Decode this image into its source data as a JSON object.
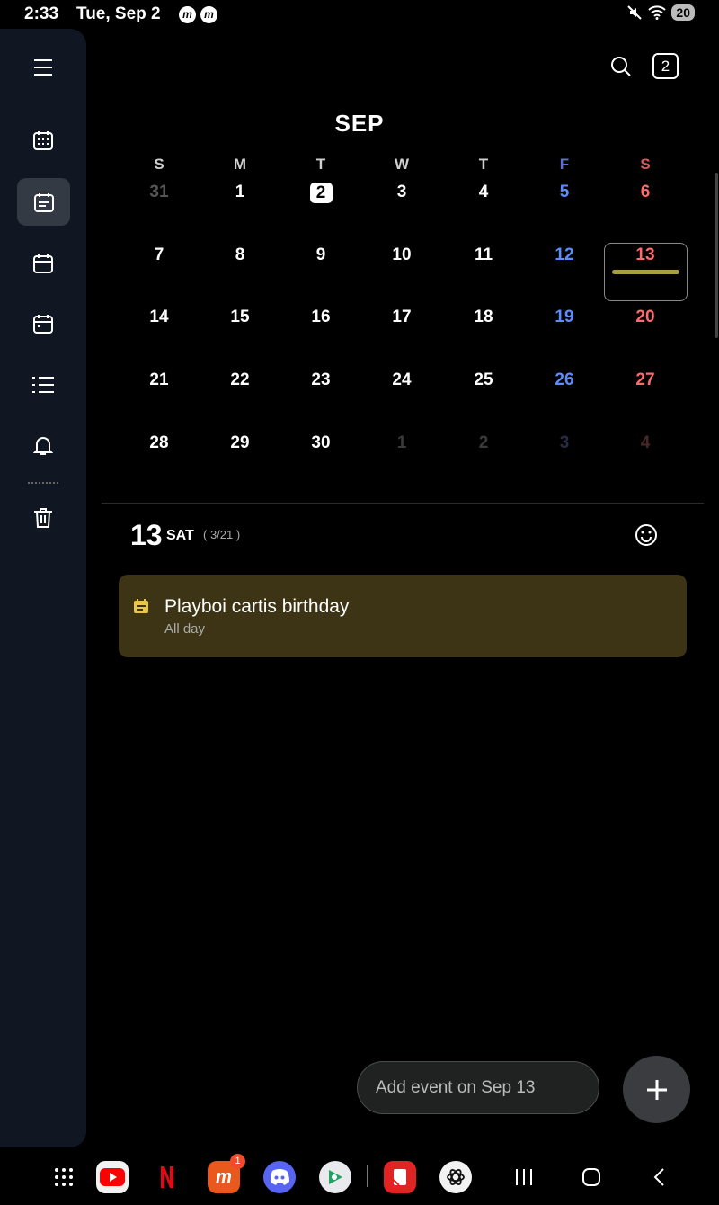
{
  "status_bar": {
    "time": "2:33",
    "date": "Tue, Sep 2",
    "notif_glyph": "m",
    "battery": "20"
  },
  "header": {
    "month": "SEP",
    "today_button": "2"
  },
  "calendar": {
    "weekdays": [
      "S",
      "M",
      "T",
      "W",
      "T",
      "F",
      "S"
    ],
    "weeks": [
      [
        "31",
        "1",
        "2",
        "3",
        "4",
        "5",
        "6"
      ],
      [
        "7",
        "8",
        "9",
        "10",
        "11",
        "12",
        "13"
      ],
      [
        "14",
        "15",
        "16",
        "17",
        "18",
        "19",
        "20"
      ],
      [
        "21",
        "22",
        "23",
        "24",
        "25",
        "26",
        "27"
      ],
      [
        "28",
        "29",
        "30",
        "1",
        "2",
        "3",
        "4"
      ]
    ],
    "today": "2",
    "selected": "13"
  },
  "selected_day": {
    "number": "13",
    "weekday": "SAT",
    "lunar": "( 3/21 )"
  },
  "event": {
    "title": "Playboi cartis birthday",
    "subtitle": "All day",
    "color": "#3c3414"
  },
  "add_event": {
    "label": "Add event on Sep 13"
  },
  "navbar": {
    "messenger_badge": "1"
  },
  "colors": {
    "saturday": "#ff6b6b",
    "friday": "#5b8dff",
    "sidebar_bg": "#111722",
    "event_bar": "#aa9f3f"
  }
}
